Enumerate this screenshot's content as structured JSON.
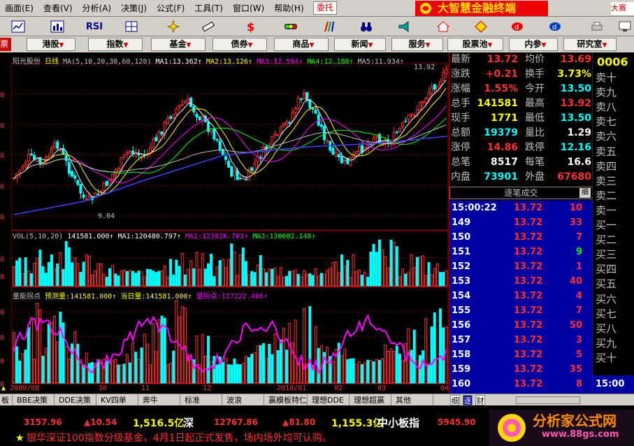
{
  "menu": {
    "items": [
      "画面(E)",
      "查看(V)",
      "分析(A)",
      "决策(J)",
      "公式(F)",
      "工具(T)",
      "窗口(W)",
      "帮助(H)"
    ],
    "commission": "委托",
    "brand": "大智慧金融终端",
    "right": "大赛"
  },
  "toolbar": {
    "rsi": "RSI"
  },
  "funcbar": {
    "left": "票",
    "buttons": [
      "港股",
      "指数",
      "基金",
      "债券",
      "商品",
      "新闻",
      "服务",
      "股票池",
      "内参",
      "研究室"
    ]
  },
  "chart": {
    "stock_name": "阳光股份",
    "period": "日线",
    "ma_params": "MA(5,10,20,30,60,120)",
    "ma": [
      {
        "label": "MA1:",
        "value": "13.362↑",
        "color": "#ffffff"
      },
      {
        "label": "MA2:",
        "value": "13.126↑",
        "color": "#ffff00"
      },
      {
        "label": "MA3:",
        "value": "12.594↑",
        "color": "#ff00ff"
      },
      {
        "label": "MA4:",
        "value": "12.188↑",
        "color": "#00ff00"
      },
      {
        "label": "MA5:",
        "value": "11.934↑",
        "color": "#c0c0c0"
      }
    ],
    "high_label": "13.92",
    "low_label": "9.04",
    "vol_params": "VOL(5,10,20)",
    "vol_value": "141581.000↑",
    "vol_ma": [
      {
        "label": "MA1:",
        "value": "120480.797↑",
        "color": "#ffffff"
      },
      {
        "label": "MA2:",
        "value": "123826.703↑",
        "color": "#ff00ff"
      },
      {
        "label": "MA3:",
        "value": "130602.148↑",
        "color": "#00ff00"
      }
    ],
    "ind_name": "量能拐点",
    "ind_items": [
      {
        "label": "预测量:",
        "value": "141581.000↑",
        "color": "#ffff00"
      },
      {
        "label": "当日量:",
        "value": "141581.000↑",
        "color": "#ffff00"
      },
      {
        "label": "量拐点:",
        "value": "117222.406↑",
        "color": "#ff00ff"
      }
    ],
    "x_labels": [
      "2009/08",
      "10",
      "11",
      "12",
      "2010/01",
      "02",
      "03",
      "04"
    ],
    "price_axis": [
      "0",
      "0",
      "0",
      "0",
      "0",
      "0"
    ],
    "vol_axis": [
      "0",
      "0"
    ],
    "ind_axis": [
      "0",
      "0",
      "0",
      "0"
    ]
  },
  "quote": {
    "code": "0006",
    "rows": [
      {
        "l1": "最新",
        "v1": "13.72",
        "c1": "#ff3030",
        "l2": "均价",
        "v2": "13.69",
        "c2": "#ff3030"
      },
      {
        "l1": "涨跌",
        "v1": "+0.21",
        "c1": "#ff3030",
        "l2": "换手",
        "v2": "3.73%",
        "c2": "#ffff00"
      },
      {
        "l1": "涨幅",
        "v1": "1.55%",
        "c1": "#ff3030",
        "l2": "今开",
        "v2": "13.50",
        "c2": "#00ffff"
      },
      {
        "l1": "总手",
        "v1": "141581",
        "c1": "#ffff00",
        "l2": "最高",
        "v2": "13.92",
        "c2": "#ff3030"
      },
      {
        "l1": "现手",
        "v1": "1771",
        "c1": "#ffff00",
        "l2": "最低",
        "v2": "13.50",
        "c2": "#00ffff"
      },
      {
        "l1": "总额",
        "v1": "19379",
        "c1": "#00ffff",
        "l2": "量比",
        "v2": "1.29",
        "c2": "#ffffff"
      },
      {
        "l1": "涨停",
        "v1": "14.86",
        "c1": "#ff3030",
        "l2": "跌停",
        "v2": "12.16",
        "c2": "#00ffff"
      },
      {
        "l1": "总笔",
        "v1": "8517",
        "c1": "#ffffff",
        "l2": "每笔",
        "v2": "16.6",
        "c2": "#ffffff"
      },
      {
        "l1": "内盘",
        "v1": "73901",
        "c1": "#00ffff",
        "l2": "外盘",
        "v2": "67680",
        "c2": "#ff3030"
      }
    ]
  },
  "ticks": {
    "title": "逐笔成交",
    "detail": "细",
    "rows": [
      {
        "time": "15:00:22",
        "price": "13.72",
        "vol": "10",
        "color": "#ff3030"
      },
      {
        "time": "149",
        "price": "13.72",
        "vol": "33",
        "color": "#ff3030"
      },
      {
        "time": "150",
        "price": "13.72",
        "vol": "7",
        "color": "#ff3030"
      },
      {
        "time": "151",
        "price": "13.72",
        "vol": "9",
        "color": "#00ff00"
      },
      {
        "time": "152",
        "price": "13.72",
        "vol": "1",
        "color": "#ff3030"
      },
      {
        "time": "153",
        "price": "13.72",
        "vol": "40",
        "color": "#ff3030"
      },
      {
        "time": "154",
        "price": "13.72",
        "vol": "4",
        "color": "#ff3030"
      },
      {
        "time": "155",
        "price": "13.72",
        "vol": "7",
        "color": "#ff3030"
      },
      {
        "time": "156",
        "price": "13.72",
        "vol": "50",
        "color": "#ff3030"
      },
      {
        "time": "157",
        "price": "13.72",
        "vol": "3",
        "color": "#ff3030"
      },
      {
        "time": "158",
        "price": "13.72",
        "vol": "5",
        "color": "#ff3030"
      },
      {
        "time": "159",
        "price": "13.72",
        "vol": "35",
        "color": "#ff3030"
      },
      {
        "time": "160",
        "price": "13.72",
        "vol": "8",
        "color": "#ff3030"
      }
    ]
  },
  "orderbook": {
    "labels": [
      "卖十",
      "卖九",
      "卖八",
      "卖七",
      "卖六",
      "卖五",
      "卖四",
      "卖三",
      "卖二",
      "卖一",
      "买一",
      "买二",
      "买三",
      "买四",
      "买五",
      "买六",
      "买七",
      "买八",
      "买九",
      "买十"
    ],
    "time": "15:00"
  },
  "tabs": {
    "left": [
      "板",
      "BBE决策",
      "DDE决策",
      "KV四单",
      "奔牛",
      "标准",
      "波浪",
      "赢模板特仁",
      "理想DDE",
      "理想超赢",
      "其他"
    ],
    "right": [
      "细",
      "逐",
      "财"
    ]
  },
  "index_bar": {
    "sh_value": "3157.96",
    "sh_change": "▲10.54",
    "sh_amount": "1,516.5亿",
    "sz_label": "深",
    "sz_value": "12767.86",
    "sz_change": "▲81.80",
    "sz_amount": "1,155.3亿",
    "sme_label": "中小板指",
    "sme_value": "5945.90"
  },
  "marquee": {
    "star": "★",
    "text": "银华深证100指数分级基金，4月1日起正式发售，场内场外均可认购。"
  },
  "watermark": {
    "text": "分析家公式网",
    "url": "www.88gs.com"
  },
  "colors": {
    "up": "#ff3030",
    "down": "#00ffff",
    "border": "#800000"
  }
}
